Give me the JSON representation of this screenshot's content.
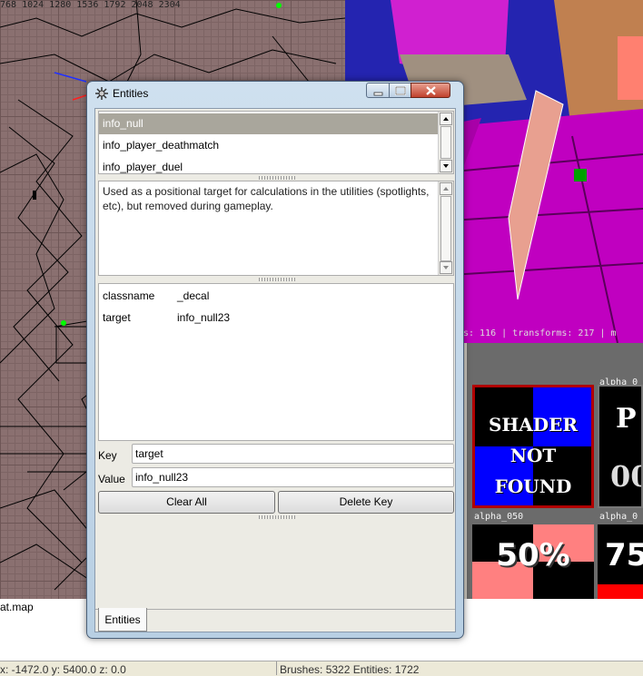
{
  "background": {
    "grid_ruler": "768    1024    1280    1536    1792    2048    2304",
    "camera_status": "s: 116 | transforms: 217 | m",
    "tex_labels": [
      "alpha_0",
      "alpha_050",
      "alpha_0"
    ],
    "tile_notfound_lines": [
      "SHADER",
      "NOT",
      "FOUND"
    ],
    "tile_p_text": "P",
    "tile_p_text2": "00",
    "tile_50_text": "50%",
    "tile_75_text": "75",
    "map_name": "at.map",
    "status_coords": "x: -1472.0  y: 5400.0  z: 0.0",
    "status_counts": "Brushes: 5322 Entities: 1722"
  },
  "window": {
    "title": "Entities",
    "class_list": [
      "info_null",
      "info_player_deathmatch",
      "info_player_duel"
    ],
    "selected_index": 0,
    "description": "Used as a positional target for calculations in the utilities (spotlights, etc), but removed during gameplay.",
    "properties": [
      {
        "key": "classname",
        "value": "_decal"
      },
      {
        "key": "target",
        "value": "info_null23"
      }
    ],
    "key_label": "Key",
    "key_value": "target",
    "value_label": "Value",
    "value_value": "info_null23",
    "clear_all_label": "Clear All",
    "delete_key_label": "Delete Key",
    "tab_label": "Entities"
  },
  "colors": {
    "selection": "#a9a69c",
    "camera_magenta": "#c000c0",
    "camera_sky": "#1a1aa0",
    "shader_blue": "#0000ff"
  }
}
